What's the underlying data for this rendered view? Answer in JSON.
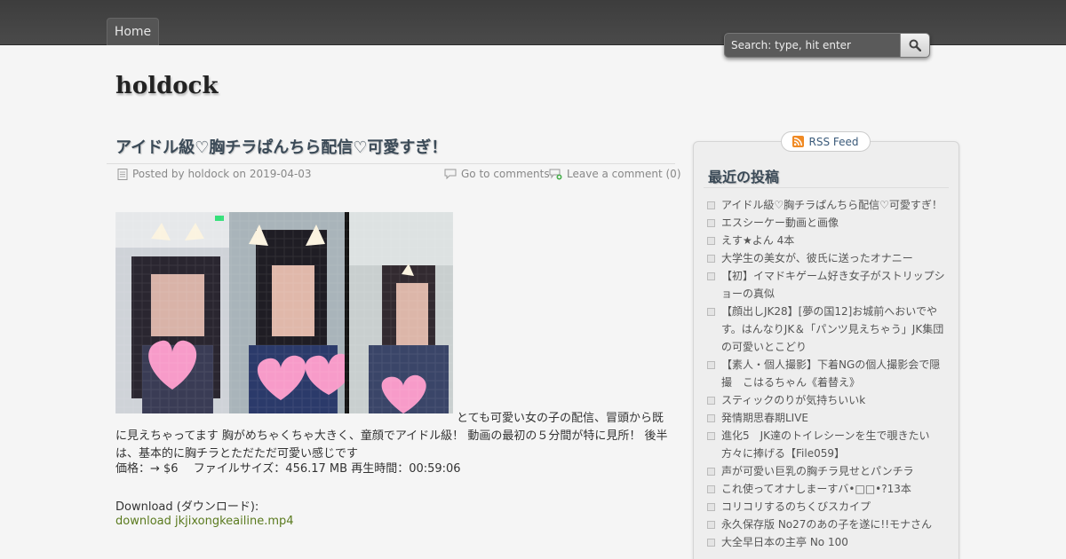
{
  "nav": {
    "home_label": "Home"
  },
  "search": {
    "placeholder": "Search: type, hit enter"
  },
  "site": {
    "title": "holdock"
  },
  "post": {
    "title": "アイドル級♡胸チラぱんちら配信♡可愛すぎ！",
    "meta": {
      "posted": "Posted by holdock on 2019-04-03",
      "comments_link": "Go to comments",
      "leave_comment": "Leave a comment (0)"
    },
    "body_lead": "とても可愛い女の子の配信、冒頭から既",
    "body_rest": "に見えちゃってます 胸がめちゃくちゃ大きく、童顔でアイドル級！ 動画の最初の５分間が特に見所！ 後半は、基本的に胸チラとただただ可愛い感じです",
    "price_line": "価格：→ $6　 ファイルサイズ：456.17 MB 再生時間：00:59:06",
    "download_label": "Download (ダウンロード):",
    "download_link": "download jkjixongkeailine.mp4"
  },
  "sidebar": {
    "rss_label": "RSS Feed",
    "recent_heading": "最近の投稿",
    "recent_posts": [
      "アイドル級♡胸チラぱんちら配信♡可愛すぎ！",
      "エスシーケー動画と画像",
      "えす★よん 4本",
      "大学生の美女が、彼氏に送ったオナニー",
      "【初】イマドキゲーム好き女子がストリップショーの真似",
      "【顔出しJK28】[夢の国12]お城前へおいでやす。はんなりJK＆「パンツ見えちゃう」JK集団の可愛いとこどり",
      "【素人・個人撮影】下着NGの個人撮影会で隠撮　こはるちゃん《着替え》",
      "スティックのりが気持ちいいk",
      "発情期思春期LIVE",
      "進化5　JK達のトイレシーンを生で覗きたい方々に捧げる【File059】",
      "声が可愛い巨乳の胸チラ見せとパンチラ",
      "これ使ってオナしまーすバ•□□•?13本",
      "コリコリするのちくびスカイプ",
      "永久保存版 No27のあの子を遂に!!モナさん",
      "大全早日本の主亭 No 100"
    ]
  },
  "colors": {
    "topbar": "#444444",
    "title_text": "#3b4a57",
    "link_green": "#5a7a1e",
    "rss_orange": "#f08a24"
  }
}
